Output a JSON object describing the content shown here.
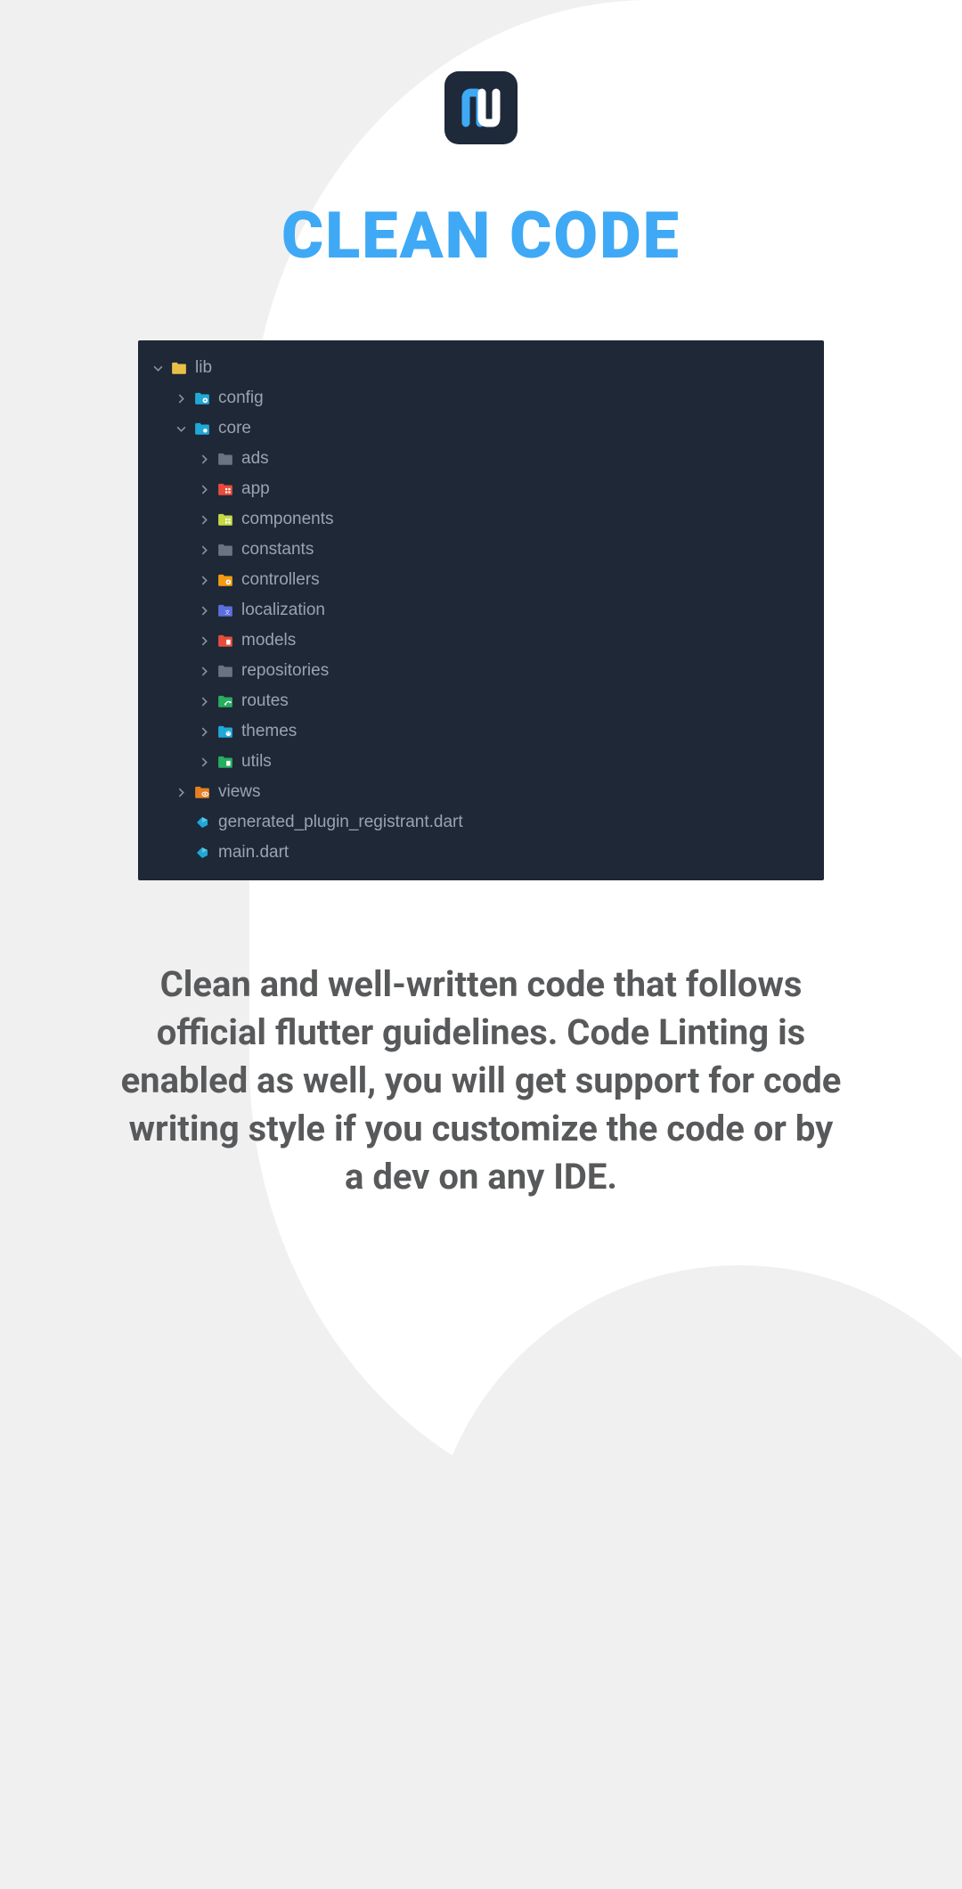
{
  "logo": {
    "name": "app-logo"
  },
  "title": "CLEAN CODE",
  "tree": [
    {
      "depth": 0,
      "chevron": "down",
      "iconType": "folder",
      "iconColor": "#e8c046",
      "label": "lib"
    },
    {
      "depth": 1,
      "chevron": "right",
      "iconType": "folder-gear",
      "iconColor": "#20a8d8",
      "label": "config"
    },
    {
      "depth": 1,
      "chevron": "down",
      "iconType": "folder-dot",
      "iconColor": "#20a8d8",
      "label": "core"
    },
    {
      "depth": 2,
      "chevron": "right",
      "iconType": "folder",
      "iconColor": "#6b7280",
      "label": "ads"
    },
    {
      "depth": 2,
      "chevron": "right",
      "iconType": "folder-grid",
      "iconColor": "#e74c3c",
      "label": "app"
    },
    {
      "depth": 2,
      "chevron": "right",
      "iconType": "folder-grid",
      "iconColor": "#c5d943",
      "label": "components"
    },
    {
      "depth": 2,
      "chevron": "right",
      "iconType": "folder",
      "iconColor": "#6b7280",
      "label": "constants"
    },
    {
      "depth": 2,
      "chevron": "right",
      "iconType": "folder-gear",
      "iconColor": "#f39c12",
      "label": "controllers"
    },
    {
      "depth": 2,
      "chevron": "right",
      "iconType": "folder-lang",
      "iconColor": "#5b6ee1",
      "label": "localization"
    },
    {
      "depth": 2,
      "chevron": "right",
      "iconType": "folder-doc",
      "iconColor": "#e74c3c",
      "label": "models"
    },
    {
      "depth": 2,
      "chevron": "right",
      "iconType": "folder",
      "iconColor": "#6b7280",
      "label": "repositories"
    },
    {
      "depth": 2,
      "chevron": "right",
      "iconType": "folder-route",
      "iconColor": "#27ae60",
      "label": "routes"
    },
    {
      "depth": 2,
      "chevron": "right",
      "iconType": "folder-palette",
      "iconColor": "#20a8d8",
      "label": "themes"
    },
    {
      "depth": 2,
      "chevron": "right",
      "iconType": "folder-doc",
      "iconColor": "#27ae60",
      "label": "utils"
    },
    {
      "depth": 1,
      "chevron": "right",
      "iconType": "folder-view",
      "iconColor": "#e67e22",
      "label": "views"
    },
    {
      "depth": 1,
      "chevron": "none",
      "iconType": "dart",
      "iconColor": "#20a8d8",
      "label": "generated_plugin_registrant.dart"
    },
    {
      "depth": 1,
      "chevron": "none",
      "iconType": "dart",
      "iconColor": "#20a8d8",
      "label": "main.dart"
    }
  ],
  "description": "Clean and well-written code that follows official flutter guidelines. Code Linting is enabled as well, you will get support for code writing style if you customize the code or by a dev on any IDE."
}
